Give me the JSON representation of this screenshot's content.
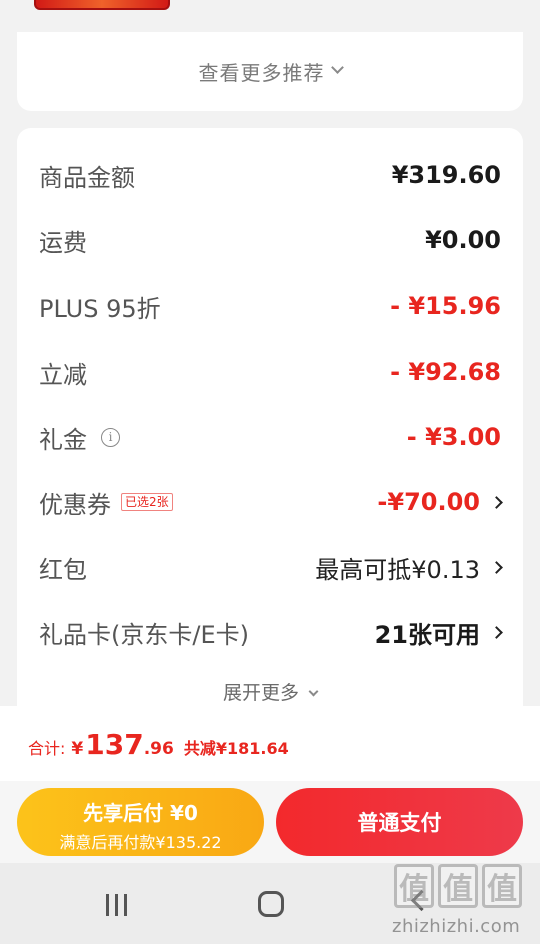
{
  "recommend": {
    "more_label": "查看更多推荐"
  },
  "summary": {
    "rows": [
      {
        "label": "商品金额",
        "value": "¥319.60"
      },
      {
        "label": "运费",
        "value": "¥0.00"
      },
      {
        "label": "PLUS 95折",
        "value": "- ¥15.96"
      },
      {
        "label": "立减",
        "value": "- ¥92.68"
      },
      {
        "label": "礼金",
        "value": "- ¥3.00",
        "info_icon": "i"
      },
      {
        "label": "优惠券",
        "tag": "已选2张",
        "value": "-¥70.00"
      },
      {
        "label": "红包",
        "value": "最高可抵¥0.13"
      },
      {
        "label": "礼品卡(京东卡/E卡)",
        "value": "21张可用"
      }
    ],
    "expand_label": "展开更多"
  },
  "total": {
    "label": "合计:",
    "currency": "¥",
    "amount_int": "137",
    "amount_dec": ".96",
    "saving": "共减¥181.64"
  },
  "actions": {
    "later_title": "先享后付 ¥0",
    "later_sub": "满意后再付款¥135.22",
    "pay_label": "普通支付"
  },
  "watermark": {
    "logo_chars": [
      "值",
      "值",
      "值"
    ],
    "site": "zhizhizhi.com"
  },
  "colors": {
    "accent_red": "#e8261f",
    "pay_red": "#f3292c",
    "later_yellow": "#fcc31a"
  },
  "icons": [
    "info-icon",
    "chevron-down-icon",
    "chevron-right-icon",
    "nav-recents-icon",
    "nav-home-icon",
    "nav-back-icon"
  ]
}
